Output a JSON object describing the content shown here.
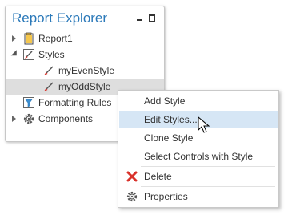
{
  "panel": {
    "title": "Report Explorer",
    "minimize_icon": "minimize-icon",
    "maximize_icon": "maximize-icon"
  },
  "tree": {
    "items": [
      {
        "label": "Report1",
        "icon": "report-clipboard-icon",
        "toggle": "collapsed"
      },
      {
        "label": "Styles",
        "icon": "styles-brush-icon",
        "toggle": "expanded"
      },
      {
        "label": "myEvenStyle",
        "icon": "style-brush-icon"
      },
      {
        "label": "myOddStyle",
        "icon": "style-brush-icon",
        "selected": true
      },
      {
        "label": "Formatting Rules",
        "icon": "formatting-rules-icon"
      },
      {
        "label": "Components",
        "icon": "gear-icon",
        "toggle": "collapsed"
      }
    ]
  },
  "context_menu": {
    "items": [
      {
        "label": "Add Style"
      },
      {
        "label": "Edit Styles...",
        "highlighted": true
      },
      {
        "label": "Clone Style"
      },
      {
        "label": "Select Controls with Style"
      },
      {
        "label": "Delete",
        "icon": "delete-x-icon"
      },
      {
        "label": "Properties",
        "icon": "gear-icon"
      }
    ]
  },
  "colors": {
    "title": "#2b79b9",
    "highlight": "#d6e6f5",
    "selected": "#dedede",
    "delete": "#d9322b"
  }
}
